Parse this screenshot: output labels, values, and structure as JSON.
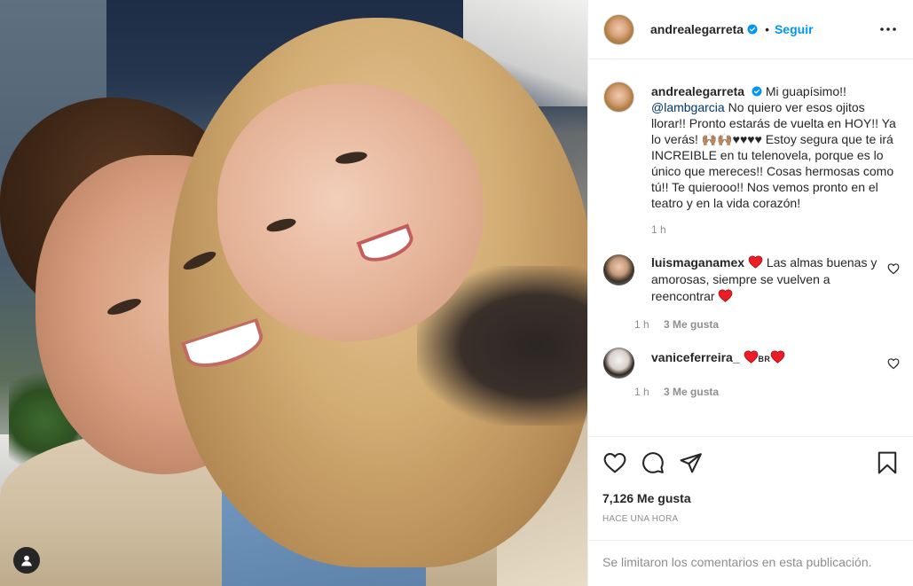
{
  "header": {
    "username": "andrealegarreta",
    "separator": "•",
    "follow_label": "Seguir",
    "more_icon": "more-horizontal-icon"
  },
  "caption": {
    "username": "andrealegarreta",
    "text_1": "Mi guapísimo!!",
    "mention": "@lambgarcia",
    "text_2": "No quiero ver esos ojitos llorar!! Pronto estarás de vuelta en HOY!! Ya lo verás! 🙌🏽🙌🏽♥♥♥♥ Estoy segura que te irá INCREIBLE en tu telenovela, porque es lo único que mereces!! Cosas hermosas como tú!! Te quierooo!! Nos vemos pronto en el teatro y en la vida corazón!",
    "time": "1 h"
  },
  "comments": [
    {
      "username": "luismaganamex",
      "text": "Las almas buenas y amorosas, siempre se vuelven a reencontrar",
      "time": "1 h",
      "likes": "3 Me gusta"
    },
    {
      "username": "vaniceferreira_",
      "flag": "BR",
      "time": "1 h",
      "likes": "3 Me gusta"
    }
  ],
  "actions": {
    "like_icon": "heart-icon",
    "comment_icon": "comment-icon",
    "share_icon": "send-icon",
    "save_icon": "bookmark-icon",
    "likes_count": "7,126 Me gusta",
    "time_ago": "HACE UNA HORA"
  },
  "footer": {
    "notice": "Se limitaron los comentarios en esta publicación."
  },
  "colors": {
    "accent": "#0095f6",
    "verified": "#0095f6",
    "heart_red": "#ed1c24",
    "muted": "#8e8e8e"
  }
}
